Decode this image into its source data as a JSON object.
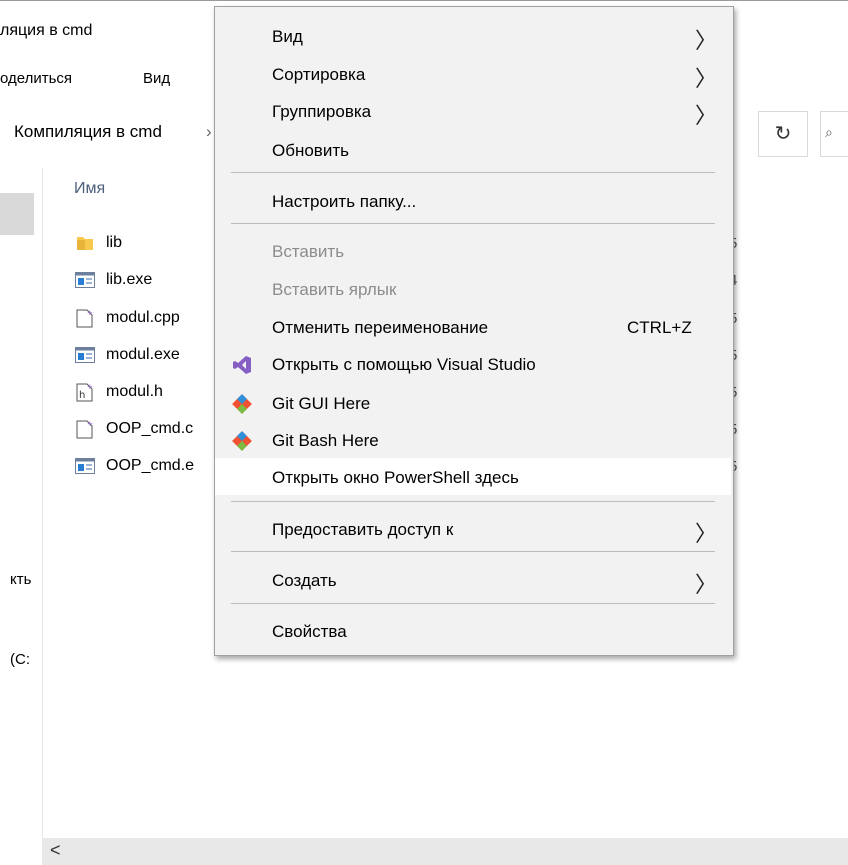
{
  "window": {
    "title": "ляция в cmd"
  },
  "ribbon": {
    "tabs": [
      "оделиться",
      "Вид"
    ]
  },
  "address": {
    "path": "Компиляция в cmd",
    "separator": "›"
  },
  "toolbar": {
    "refresh_icon": "↻",
    "search_icon": "⌕"
  },
  "file_list": {
    "column_name": "Имя",
    "files": [
      {
        "name": "lib",
        "icon": "folder-icon",
        "date_fragment": "5"
      },
      {
        "name": "lib.exe",
        "icon": "exe-icon",
        "date_fragment": "4"
      },
      {
        "name": "modul.cpp",
        "icon": "cpp-file-icon",
        "date_fragment": "5"
      },
      {
        "name": "modul.exe",
        "icon": "exe-icon",
        "date_fragment": "5"
      },
      {
        "name": "modul.h",
        "icon": "header-file-icon",
        "date_fragment": "5"
      },
      {
        "name": "OOP_cmd.c",
        "icon": "cpp-file-icon",
        "date_fragment": "5"
      },
      {
        "name": "OOP_cmd.e",
        "icon": "exe-icon",
        "date_fragment": "5"
      }
    ]
  },
  "left_pane": {
    "fragment1": "кть",
    "fragment2": "(C:"
  },
  "scrollbar": {
    "left_arrow": "<"
  },
  "context_menu": {
    "items": [
      {
        "label": "Вид",
        "submenu": true
      },
      {
        "label": "Сортировка",
        "submenu": true
      },
      {
        "label": "Группировка",
        "submenu": true
      },
      {
        "label": "Обновить"
      },
      {
        "label": "Настроить папку..."
      },
      {
        "label": "Вставить",
        "disabled": true
      },
      {
        "label": "Вставить ярлык",
        "disabled": true
      },
      {
        "label": "Отменить переименование",
        "shortcut": "CTRL+Z"
      },
      {
        "label": "Открыть с помощью Visual Studio",
        "icon": "visual-studio-icon"
      },
      {
        "label": "Git GUI Here",
        "icon": "git-icon"
      },
      {
        "label": "Git Bash Here",
        "icon": "git-icon"
      },
      {
        "label": "Открыть окно PowerShell здесь",
        "highlighted": true
      },
      {
        "label": "Предоставить доступ к",
        "submenu": true
      },
      {
        "label": "Создать",
        "submenu": true
      },
      {
        "label": "Свойства"
      }
    ],
    "arrow_glyph": "〉"
  },
  "colors": {
    "menu_bg": "#f2f2f2",
    "highlight": "#ffffff",
    "disabled_text": "#8c8c8c",
    "vs_purple": "#865fc5",
    "git_orange": "#f05133"
  }
}
